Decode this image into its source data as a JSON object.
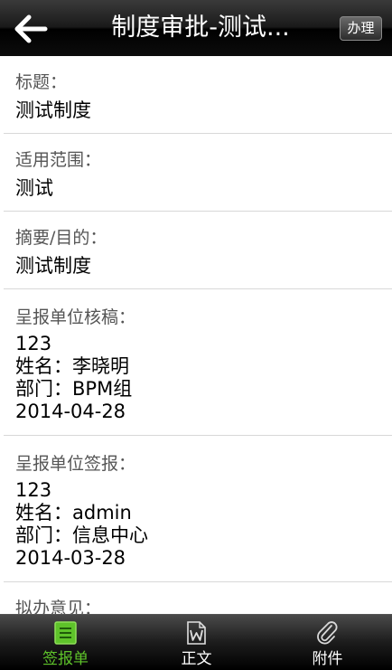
{
  "header": {
    "title": "制度审批-测试...",
    "action_label": "办理"
  },
  "sections": [
    {
      "label": "标题：",
      "lines": [
        "测试制度"
      ]
    },
    {
      "label": "适用范围：",
      "lines": [
        "测试"
      ]
    },
    {
      "label": "摘要/目的：",
      "lines": [
        "测试制度"
      ]
    },
    {
      "label": "呈报单位核稿：",
      "lines": [
        "123",
        "姓名：李晓明",
        "部门：BPM组",
        "2014-04-28"
      ]
    },
    {
      "label": "呈报单位签报：",
      "lines": [
        "123",
        "姓名：admin",
        "部门：信息中心",
        "2014-03-28"
      ]
    },
    {
      "label": "拟办意见：",
      "lines": []
    }
  ],
  "tabs": [
    {
      "label": "签报单",
      "icon": "list-icon",
      "active": true
    },
    {
      "label": "正文",
      "icon": "word-document-icon",
      "active": false
    },
    {
      "label": "附件",
      "icon": "paperclip-icon",
      "active": false
    }
  ],
  "colors": {
    "active_tab": "#5ec32a",
    "bar": "#000000"
  }
}
